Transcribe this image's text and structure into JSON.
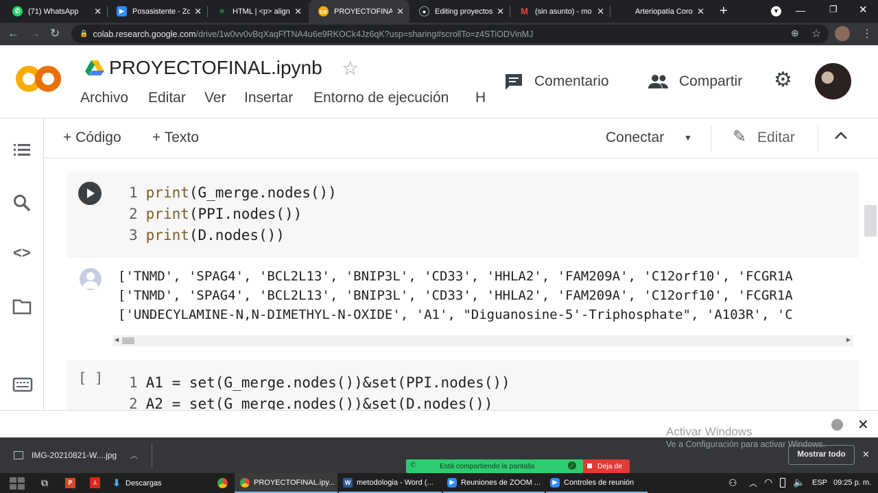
{
  "browser": {
    "tabs": [
      {
        "label": "(71) WhatsApp",
        "icon": "whatsapp-icon",
        "color": "#25d366"
      },
      {
        "label": "Posasistente - Zo",
        "icon": "zoom-icon",
        "color": "#2d8cff"
      },
      {
        "label": "HTML | <p> align",
        "icon": "gfg-icon",
        "color": "#2f8d46"
      },
      {
        "label": "PROYECTOFINAL.",
        "icon": "colab-icon",
        "color": "#f9ab00"
      },
      {
        "label": "Editing proyectos",
        "icon": "github-icon",
        "color": "#ffffff"
      },
      {
        "label": "(sin asunto) - mo",
        "icon": "gmail-icon",
        "color": "#ea4335"
      },
      {
        "label": "Arteriopatía Coro",
        "icon": "page-icon",
        "color": "#888888"
      }
    ],
    "url_domain": "colab.research.google.com",
    "url_path": "/drive/1w0vv0vBqXaqFfTNA4u6e9RKOCk4Jz6qK?usp=sharing#scrollTo=z4STiODVinMJ"
  },
  "colab": {
    "logo": "CO",
    "title": "PROYECTOFINAL.ipynb",
    "menu": [
      "Archivo",
      "Editar",
      "Ver",
      "Insertar",
      "Entorno de ejecución",
      "H"
    ],
    "comment_label": "Comentario",
    "share_label": "Compartir"
  },
  "nb_toolbar": {
    "add_code": "+ Código",
    "add_text": "+ Texto",
    "connect": "Conectar",
    "edit": "Editar"
  },
  "cell1": {
    "lines": [
      {
        "n": "1",
        "fn": "print",
        "rest": "(G_merge.nodes())"
      },
      {
        "n": "2",
        "fn": "print",
        "rest": "(PPI.nodes())"
      },
      {
        "n": "3",
        "fn": "print",
        "rest": "(D.nodes())"
      }
    ],
    "output": [
      "['TNMD', 'SPAG4', 'BCL2L13', 'BNIP3L', 'CD33', 'HHLA2', 'FAM209A', 'C12orf10', 'FCGR1A",
      "['TNMD', 'SPAG4', 'BCL2L13', 'BNIP3L', 'CD33', 'HHLA2', 'FAM209A', 'C12orf10', 'FCGR1A",
      "['UNDECYLAMINE-N,N-DIMETHYL-N-OXIDE', 'A1', \"Diguanosine-5'-Triphosphate\", 'A103R', 'C"
    ]
  },
  "cell2": {
    "bracket": "[ ]",
    "lines": [
      {
        "n": "1",
        "code": "A1 = set(G_merge.nodes())&set(PPI.nodes())"
      },
      {
        "n": "2",
        "code": "A2 = set(G_merge.nodes())&set(D.nodes())"
      }
    ]
  },
  "activation": {
    "title": "Activar Windows",
    "subtitle": "Ve a Configuración para activar Windows."
  },
  "shelf": {
    "file": "IMG-20210821-W....jpg",
    "show_all": "Mostrar todo"
  },
  "zoom_share": {
    "status": "Está compartiendo la pantalla",
    "stop": "Deja de"
  },
  "taskbar": {
    "apps": [
      {
        "label": "Descargas",
        "icon": "download-icon"
      },
      {
        "label": "PROYECTOFINAL.ipy...",
        "icon": "chrome-icon"
      },
      {
        "label": "metodologia - Word (...",
        "icon": "word-icon"
      },
      {
        "label": "Reuniones de ZOOM ...",
        "icon": "zoom-icon"
      },
      {
        "label": "Controles de reunión",
        "icon": "zoom-icon"
      }
    ],
    "lang": "ESP",
    "time": "09:25 p. m."
  }
}
